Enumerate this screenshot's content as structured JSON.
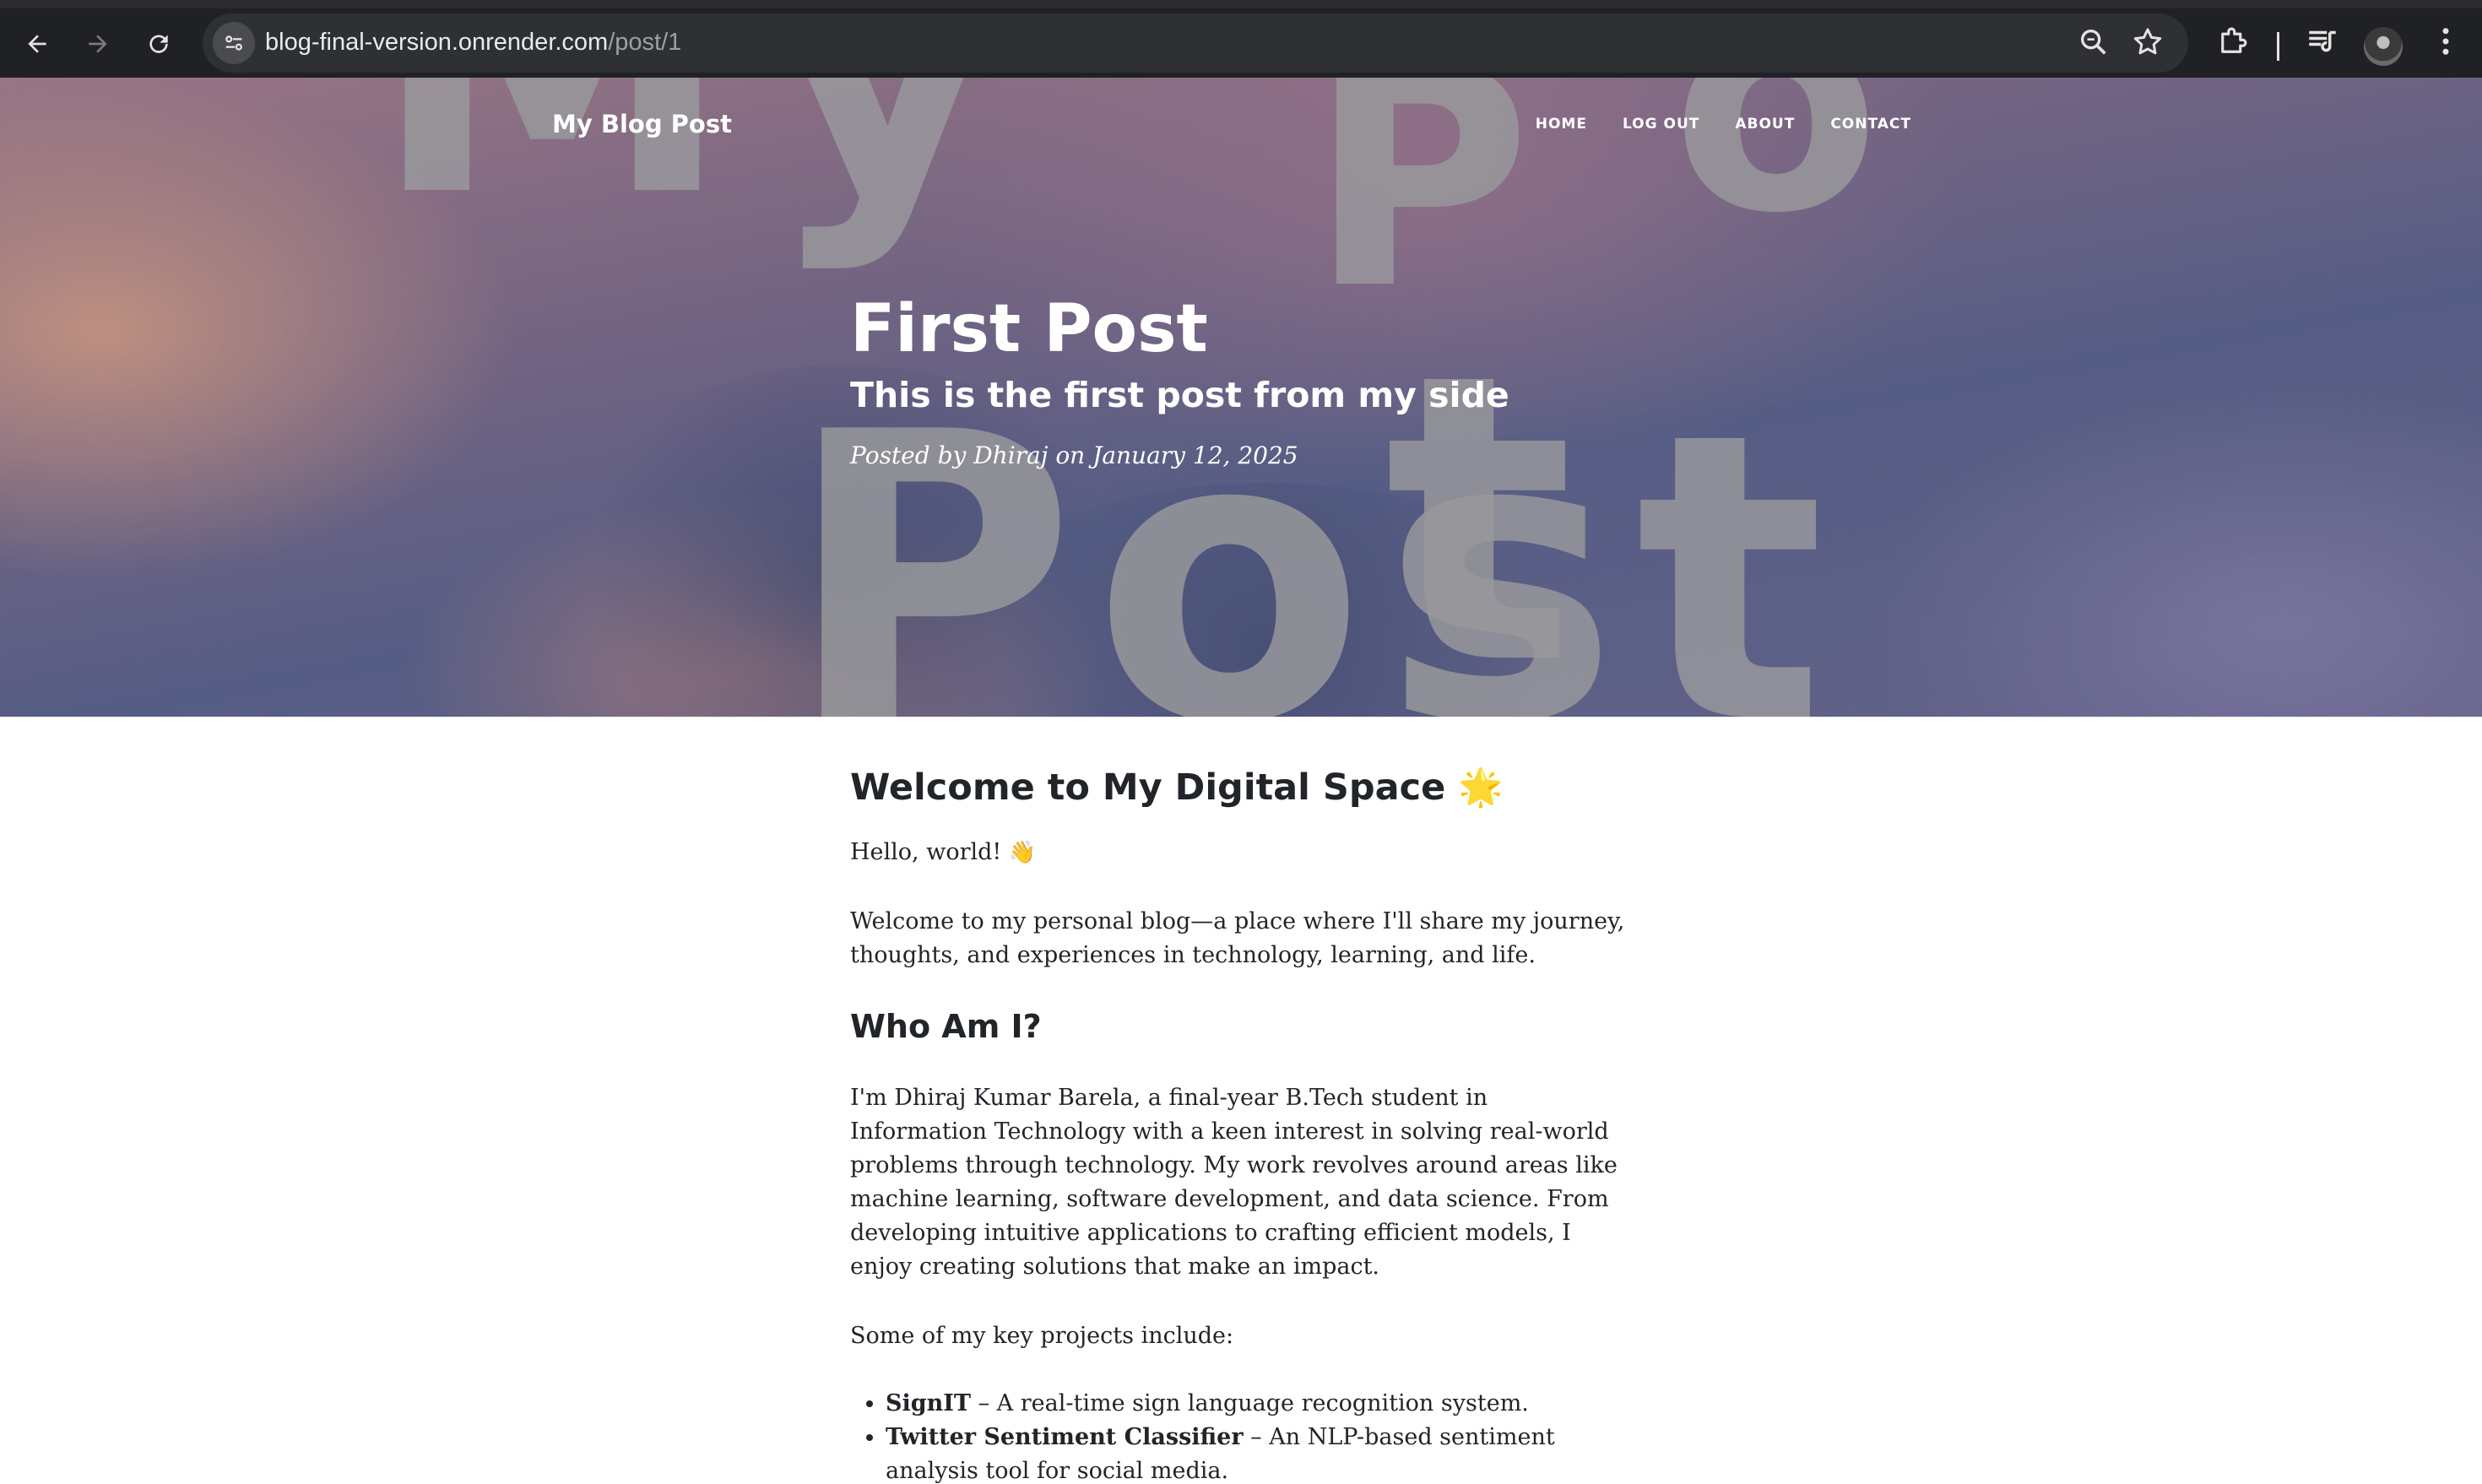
{
  "browser": {
    "url_host": "blog-final-version.onrender.com",
    "url_path": "/post/1",
    "back_icon": "arrow-left-icon",
    "forward_icon": "arrow-right-icon",
    "reload_icon": "reload-icon",
    "site_info_icon": "tune-icon",
    "zoom_icon": "magnifier-zoom-icon",
    "bookmark_icon": "star-icon",
    "extensions_icon": "puzzle-icon",
    "media_icon": "playlist-icon",
    "menu_icon": "kebab-menu-icon"
  },
  "navbar": {
    "brand": "My Blog Post",
    "links": [
      "HOME",
      "LOG OUT",
      "ABOUT",
      "CONTACT"
    ]
  },
  "hero": {
    "title": "First Post",
    "subtitle": "This is the first post from my side",
    "meta": "Posted by Dhiraj on January 12, 2025",
    "background_words": [
      "My",
      "Post"
    ]
  },
  "article": {
    "heading": "Welcome to My Digital Space",
    "heading_emoji": "🌟",
    "greeting": "Hello, world!",
    "greeting_emoji": "👋",
    "intro": "Welcome to my personal blog—a place where I'll share my journey, thoughts, and experiences in technology, learning, and life.",
    "who_heading": "Who Am I?",
    "who_text": "I'm Dhiraj Kumar Barela, a final-year B.Tech student in Information Technology with a keen interest in solving real-world problems through technology. My work revolves around areas like machine learning, software development, and data science. From developing intuitive applications to crafting efficient models, I enjoy creating solutions that make an impact.",
    "projects_intro": "Some of my key projects include:",
    "projects": [
      {
        "name": "SignIT",
        "desc": " – A real-time sign language recognition system."
      },
      {
        "name": "Twitter Sentiment Classifier",
        "desc": " – An NLP-based sentiment analysis tool for social media."
      }
    ]
  },
  "colors": {
    "chrome_bg": "#202124",
    "omnibox_bg": "#2f3033",
    "text_dark": "#212529",
    "hero_text": "#ffffff"
  }
}
